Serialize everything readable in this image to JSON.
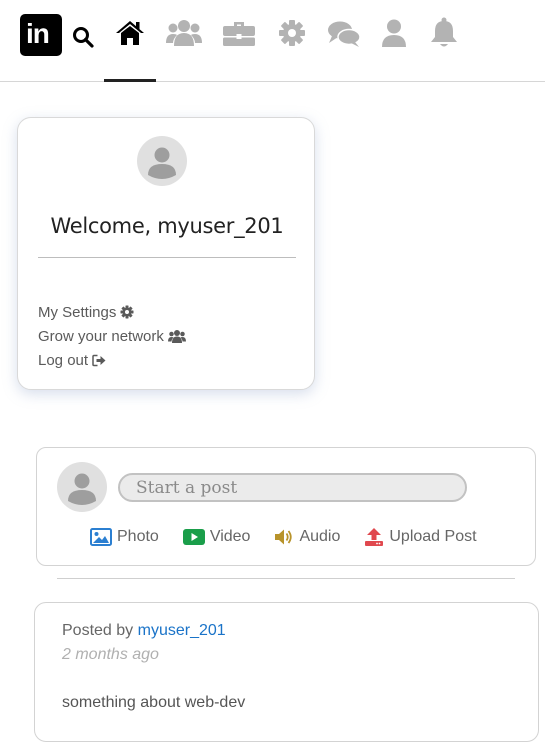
{
  "nav": {
    "logo_text": "in",
    "icons": [
      "search-icon",
      "home-icon",
      "users-icon",
      "briefcase-icon",
      "gear-icon",
      "comments-icon",
      "user-icon",
      "bell-icon"
    ]
  },
  "profile": {
    "welcome": "Welcome, myuser_201",
    "links": [
      "My Settings",
      "Grow your network",
      "Log out"
    ]
  },
  "composer": {
    "placeholder": "Start a post",
    "actions": [
      "Photo",
      "Video",
      "Audio",
      "Upload Post"
    ]
  },
  "post": {
    "posted_by_prefix": "Posted by",
    "author": "myuser_201",
    "time": "2 months ago",
    "body": "something about web-dev"
  },
  "colors": {
    "link_blue": "#1a73c8",
    "photo_blue": "#2b7fd1",
    "video_green": "#1a9e4a",
    "audio_gold": "#b8932a",
    "upload_red": "#e0484e",
    "nav_inactive": "#b3b3b3"
  }
}
